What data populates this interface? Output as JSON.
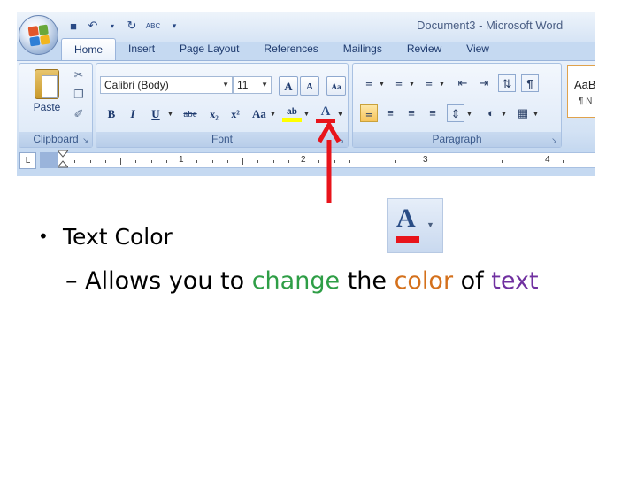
{
  "window": {
    "title": "Document3 - Microsoft Word"
  },
  "quick_access": {
    "icons": [
      "save-icon",
      "undo-icon",
      "redo-icon",
      "spelling-icon",
      "customize-icon"
    ],
    "spelling_label": "ABC"
  },
  "tabs": [
    {
      "label": "Home",
      "active": true
    },
    {
      "label": "Insert"
    },
    {
      "label": "Page Layout"
    },
    {
      "label": "References"
    },
    {
      "label": "Mailings"
    },
    {
      "label": "Review"
    },
    {
      "label": "View"
    }
  ],
  "clipboard": {
    "label": "Clipboard",
    "paste_label": "Paste"
  },
  "font": {
    "label": "Font",
    "font_name": "Calibri (Body)",
    "font_size": "11",
    "bold": "B",
    "italic": "I",
    "underline": "U",
    "strikethrough": "abe",
    "subscript": "x₂",
    "superscript": "x²",
    "change_case": "Aa",
    "highlight_label": "ab",
    "font_color_label": "A",
    "grow": "A",
    "shrink": "A",
    "clear_format": "Aa"
  },
  "paragraph": {
    "label": "Paragraph",
    "pilcrow": "¶"
  },
  "styles": {
    "preview": "AaB",
    "name": "¶ N"
  },
  "ruler": {
    "numbers": [
      "1",
      "2",
      "3",
      "4"
    ]
  },
  "colors": {
    "accent_red": "#e8141b",
    "green": "#2e9e46",
    "orange": "#d4701b",
    "purple": "#7030a0"
  },
  "slide": {
    "bullet": "•",
    "heading": "Text Color",
    "zoom_letter": "A",
    "dash": "–",
    "sub_parts": [
      {
        "text": "Allows you to ",
        "color": "#000000"
      },
      {
        "text": "change",
        "color": "#2e9e46"
      },
      {
        "text": " the ",
        "color": "#000000"
      },
      {
        "text": "color",
        "color": "#d4701b"
      },
      {
        "text": " of ",
        "color": "#000000"
      },
      {
        "text": "text",
        "color": "#7030a0"
      }
    ]
  }
}
